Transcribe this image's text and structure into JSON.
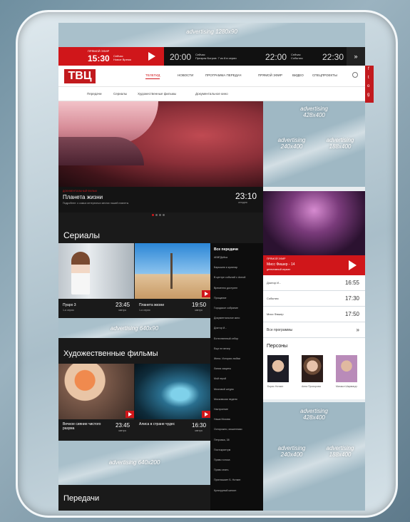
{
  "ads": {
    "top": "advertising 1280x90",
    "right1": "advertising\n428x400",
    "right2": "advertising\n240x400",
    "right3": "advertising\n188x400",
    "mid": "advertising 640x90",
    "bottom_left": "advertising 640x200",
    "right4": "advertising\n428x400",
    "right5": "advertising\n240x400",
    "right6": "advertising\n188x400"
  },
  "topbar": {
    "now_label": "ПРЯМОЙ ЭФИР",
    "now_time": "15:30",
    "now_channel": "Сейчас\nНовое Время",
    "slots": [
      {
        "time": "20:00",
        "title": "Сейчас\nПризрак Богров: 7 из 8 в серии"
      },
      {
        "time": "22:00",
        "title": "Сейчас\nСобытия"
      },
      {
        "time": "22:30",
        "title": ""
      }
    ],
    "more": "»"
  },
  "header": {
    "logo": "ТВЦ",
    "nav": [
      "ТЕЛЕГИД",
      "НОВОСТИ",
      "ПРОГРАММА ПЕРЕДАЧ",
      "ПРЯМОЙ ЭФИР",
      "ВИДЕО",
      "СПЕЦПРОЕКТЫ"
    ],
    "social": [
      "f",
      "t",
      "o",
      "g"
    ]
  },
  "subnav": [
    "Передачи",
    "Сериалы",
    "Художественные фильмы",
    "Документальное кино"
  ],
  "hero": {
    "tag": "ДОКУМЕНТАЛЬНЫЙ ФИЛЬМ",
    "title": "Планета жизни",
    "desc": "Подробнее: о самых интересных местах нашей планеты",
    "time": "23:10",
    "day": "сегодня"
  },
  "serials": {
    "heading": "Сериалы",
    "items": [
      {
        "title": "Пуаро 3",
        "episode": "1-я серия",
        "time": "23:45",
        "day": "завтра"
      },
      {
        "title": "Планета жизни",
        "episode": "1-я серия",
        "time": "19:50",
        "day": "завтра"
      }
    ]
  },
  "films": {
    "heading": "Художественные фильмы",
    "items": [
      {
        "title": "Вечное сияние чистого разума",
        "episode": "",
        "time": "23:45",
        "day": "завтра"
      },
      {
        "title": "Алиса в стране чудес",
        "episode": "",
        "time": "16:30",
        "day": "завтра"
      }
    ]
  },
  "shows_heading": "Передачи",
  "programs_list": {
    "heading": "Все передачи",
    "items": [
      "АБВГДейка",
      "Барышня и кулинар",
      "В центре событий с Анной",
      "Временно доступен",
      "Прощание",
      "Городское собрание",
      "Документальное кино",
      "Доктор И...",
      "Естественный отбор",
      "Еще не вечер",
      "Жена. История любви",
      "Линия защиты",
      "Мой герой",
      "Мозговой штурм",
      "Московская неделя",
      "Настроение",
      "Наша Москва",
      "Осторожно, мошенники",
      "Петровка, 38",
      "Постскриптум",
      "Право голоса",
      "Право знать",
      "Приглашает Б. Ноткин",
      "Культурный шпион"
    ]
  },
  "live": {
    "label": "ПРЯМОЙ ЭФИР",
    "title": "Мисс Фишер - 14",
    "sub": "детективный сериал",
    "schedule": [
      {
        "name": "Доктор И...",
        "time": "16:55"
      },
      {
        "name": "События",
        "time": "17:30"
      },
      {
        "name": "Мисс Фишер",
        "time": "17:50"
      }
    ],
    "all": "Все программы",
    "more": "»"
  },
  "persons": {
    "heading": "Персоны",
    "items": [
      {
        "name": "Борис Ноткин"
      },
      {
        "name": "Анна Прохорова"
      },
      {
        "name": "Михаил Ширвиндт"
      }
    ]
  },
  "colors": {
    "brand": "#d0161a",
    "dark": "#1a1a1a",
    "frame_bg": "#a9c0cb"
  }
}
